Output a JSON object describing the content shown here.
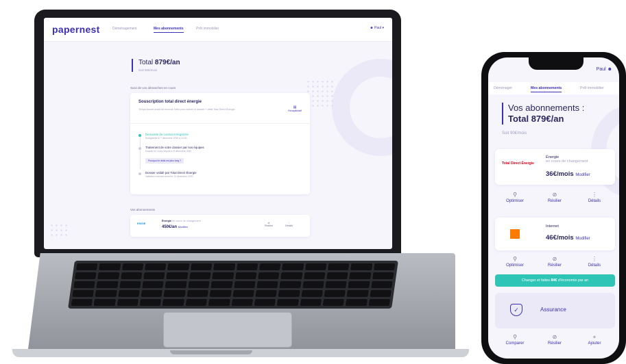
{
  "laptop": {
    "logo": "papernest",
    "nav": {
      "tabs": [
        "Déménagement",
        "Mes abonnements",
        "Prêt immobilier"
      ],
      "active_tab": "Mes abonnements",
      "user": "Paul"
    },
    "summary": {
      "title_prefix": "Total",
      "total": "879€/an",
      "subtitle": "Soit 90€/mois"
    },
    "followup_label": "Suivi de vos démarches en cours",
    "subscription_card": {
      "title": "Souscription total direct énergie",
      "description": "Temps écoulé avant de recevoir l'offre pour activer le dossier + délai Total Direct Énergie",
      "link": "Récapitulatif",
      "steps": [
        {
          "title": "Demande de contrat enregistrée",
          "date": "Enregistrée le 7 décembre 2020 à 10:00",
          "done": true
        },
        {
          "title": "Traitement de votre dossier par nos équipes",
          "date": "Dossier en cours depuis le 8 décembre 2020",
          "done": false,
          "button": "Pourquoi le délai est plus long ?"
        },
        {
          "title": "Dossier validé par Total Direct Énergie",
          "date": "Validation estimée avant le 10 décembre 2020",
          "done": false
        }
      ]
    },
    "subscriptions_label": "Vos abonnements",
    "subscription_row": {
      "logo": "ENGIE",
      "category": "Énergie",
      "status": "en cours de changement",
      "price": "450€/an",
      "modify": "Modifier",
      "actions": [
        "Résilier",
        "Détails"
      ]
    }
  },
  "phone": {
    "user": "Paul",
    "tabs": [
      "Déménager",
      "Mes abonnements",
      "Prêt immobilier"
    ],
    "active_tab": "Mes abonnements",
    "title": "Vos abonnements :",
    "total": "Total 879€/an",
    "subtitle": "Soit 90€/mois",
    "cards": [
      {
        "logo": "Total Direct Énergie",
        "logo_color": "#e2001a",
        "category": "Énergie",
        "status": "en cours de changement",
        "price": "36€/mois",
        "modify": "Modifier"
      },
      {
        "logo": "orange",
        "logo_color": "#ff7a00",
        "category": "Internet",
        "status": "",
        "price": "46€/mois",
        "modify": "Modifier"
      }
    ],
    "actions": [
      "Optimiser",
      "Résilier",
      "Détails"
    ],
    "banner_text": "Changer et faites ",
    "banner_amount": "84€",
    "banner_suffix": " d'économie par an",
    "assurance": "Assurance",
    "bottom_actions": [
      "Comparer",
      "Résilier",
      "Ajouter"
    ]
  },
  "colors": {
    "brand": "#3c2fb8",
    "accent": "#2ec4b6",
    "text": "#2a2560",
    "muted": "#a3a1bf",
    "orange": "#ff7a00"
  }
}
